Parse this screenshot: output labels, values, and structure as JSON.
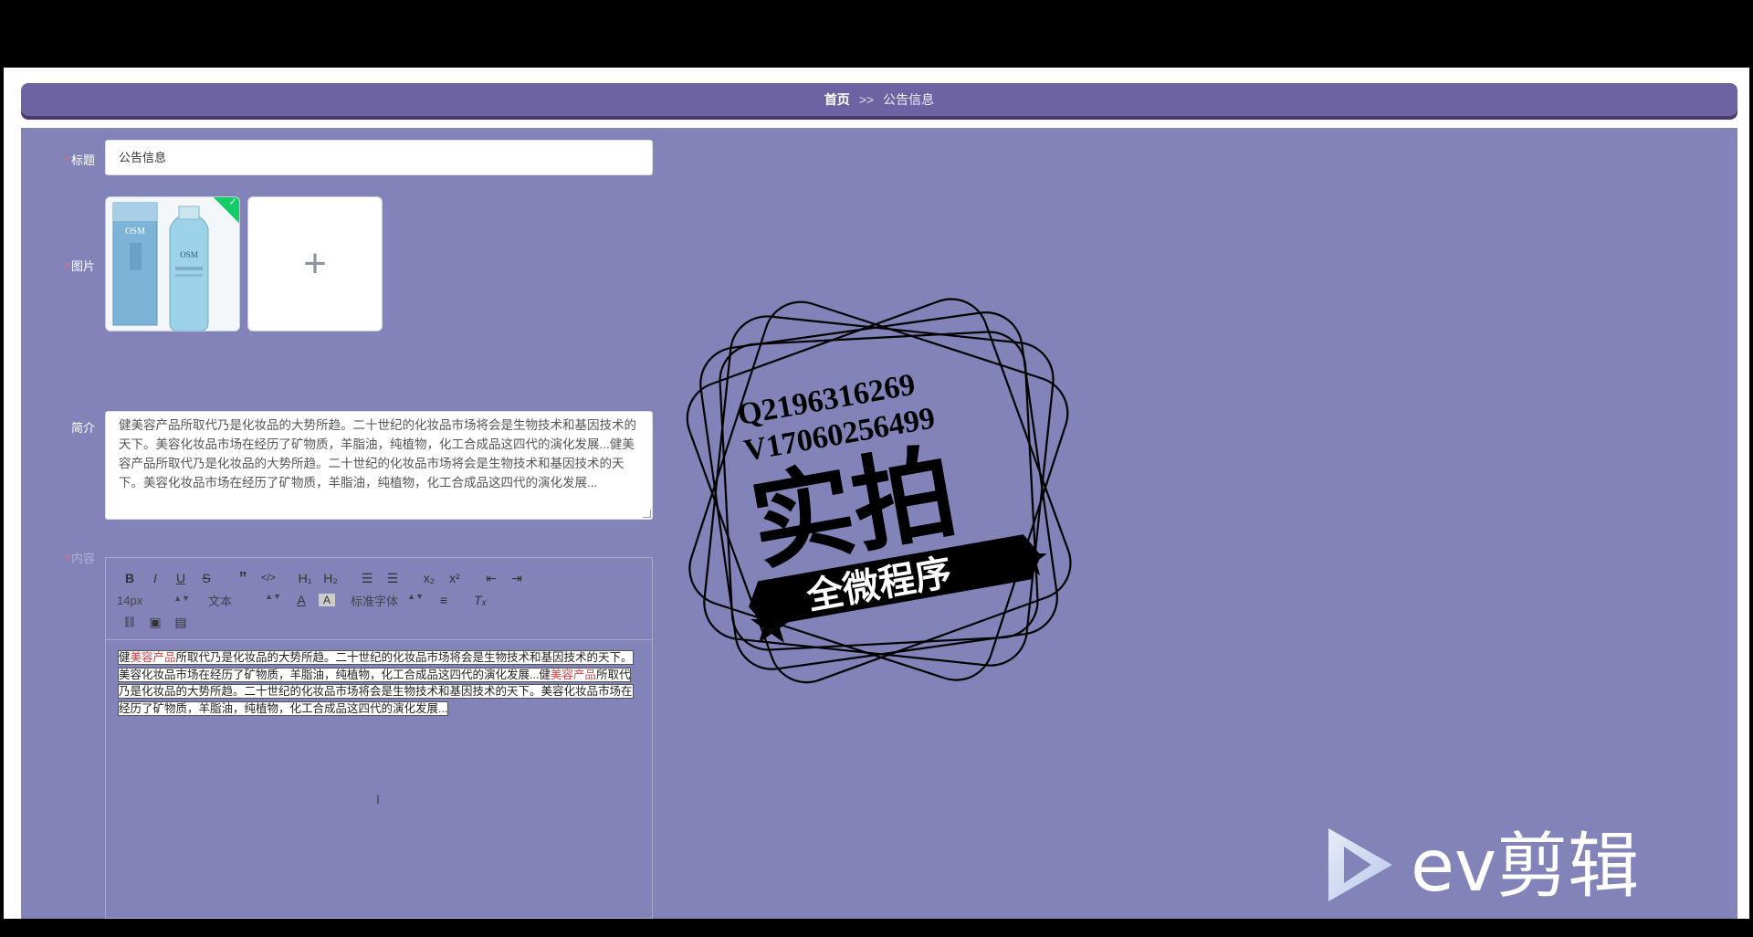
{
  "breadcrumb": {
    "home": "首页",
    "separator": ">>",
    "current": "公告信息"
  },
  "form": {
    "title_label": "标题",
    "title_value": "公告信息",
    "image_label": "图片",
    "upload_tip": "",
    "intro_label": "简介",
    "intro_value": "健美容产品所取代乃是化妆品的大势所趋。二十世纪的化妆品市场将会是生物技术和基因技术的天下。美容化妆品市场在经历了矿物质，羊脂油，纯植物，化工合成品这四代的演化发展...健美容产品所取代乃是化妆品的大势所趋。二十世纪的化妆品市场将会是生物技术和基因技术的天下。美容化妆品市场在经历了矿物质，羊脂油，纯植物，化工合成品这四代的演化发展...",
    "content_label": "内容",
    "required_mark": "*"
  },
  "image_upload": {
    "product_logo": "OSM",
    "add_symbol": "+"
  },
  "editor": {
    "toolbar": {
      "bold": "B",
      "italic": "I",
      "underline": "U",
      "strike": "S",
      "quote": "”",
      "code": "</>",
      "h1": "H₁",
      "h2": "H₂",
      "ordered": "☰",
      "bullet": "☰",
      "sub": "x₂",
      "sup": "x²",
      "outdent": "⇤",
      "indent": "⇥",
      "font_size": "14px",
      "header": "文本",
      "font_color": "A",
      "bg_color": "A",
      "font_family": "标准字体",
      "align": "≡",
      "clean": "Tₓ",
      "link": "🔗",
      "image": "▣",
      "video": "▤"
    },
    "content_parts": [
      {
        "text": "健",
        "red": false
      },
      {
        "text": "美容产品",
        "red": true
      },
      {
        "text": "所取代乃是化妆品的大势所趋。二十世纪的化妆品市场将会是生物技术和基因技术的天下。美容化妆品市场在经历了矿物质，羊脂油，纯植物，化工合成品这四代的演化发展...健",
        "red": false
      },
      {
        "text": "美容产品",
        "red": true
      },
      {
        "text": "所取代乃是化妆品的大势所趋。二十世纪的化妆品市场将会是生物技术和基因技术的天下。美容化妆品市场在经历了矿物质，羊脂油，纯植物，化工合成品这四代的演化发展...",
        "red": false
      }
    ]
  },
  "watermark": {
    "qq": "Q2196316269",
    "wechat": "V17060256499",
    "title": "实拍",
    "banner": "全微程序"
  },
  "ev_logo": {
    "text": "ev剪辑"
  },
  "colors": {
    "panel_bg": "#8283b9",
    "breadcrumb_bg": "#6e63a2",
    "required": "#f56c6c",
    "success": "#13ce66"
  }
}
